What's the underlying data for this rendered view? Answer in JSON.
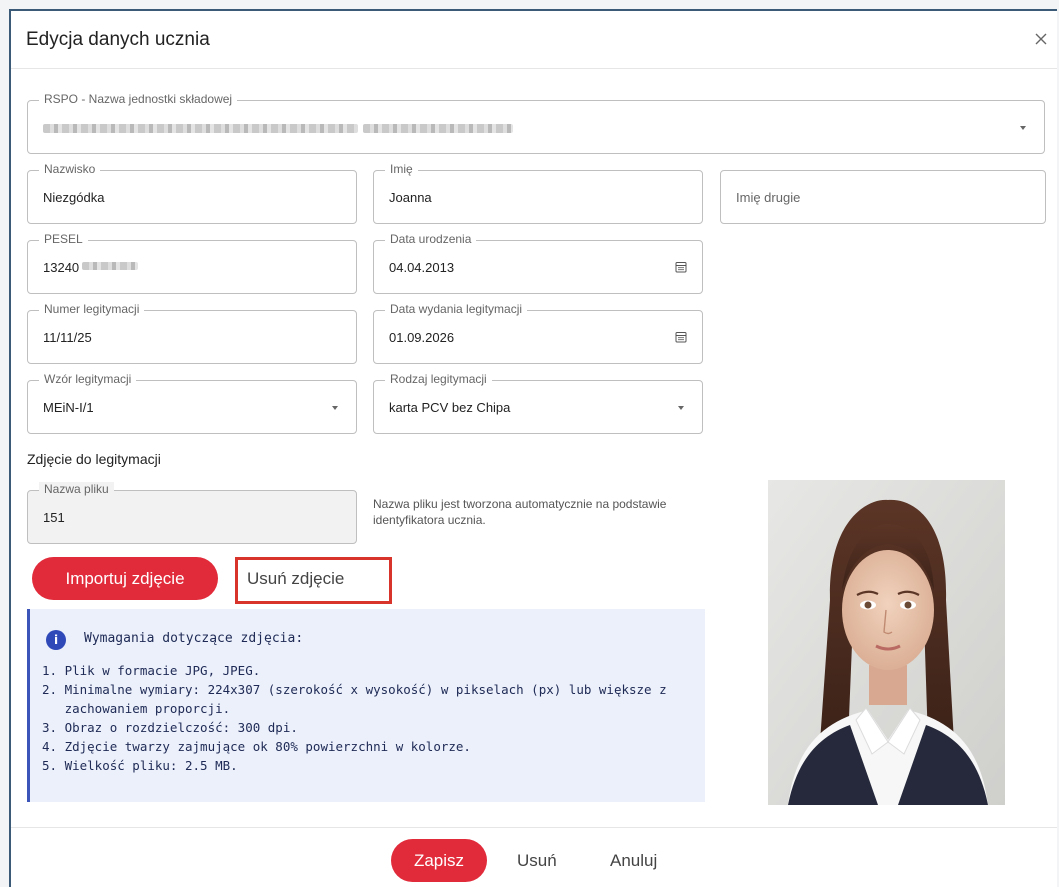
{
  "dialog": {
    "title": "Edycja danych ucznia"
  },
  "form": {
    "rspo": {
      "label": "RSPO - Nazwa jednostki składowej",
      "value": ""
    },
    "nazwisko": {
      "label": "Nazwisko",
      "value": "Niezgódka"
    },
    "imie": {
      "label": "Imię",
      "value": "Joanna"
    },
    "imie_drugie": {
      "placeholder": "Imię drugie",
      "value": ""
    },
    "pesel": {
      "label": "PESEL",
      "value": "13240"
    },
    "data_urodzenia": {
      "label": "Data urodzenia",
      "value": "04.04.2013"
    },
    "numer_legitymacji": {
      "label": "Numer legitymacji",
      "value": "11/11/25"
    },
    "data_wydania": {
      "label": "Data wydania legitymacji",
      "value": "01.09.2026"
    },
    "wzor": {
      "label": "Wzór legitymacji",
      "value": "MEiN-I/1"
    },
    "rodzaj": {
      "label": "Rodzaj legitymacji",
      "value": "karta PCV bez Chipa"
    }
  },
  "photo_section": {
    "title": "Zdjęcie do legitymacji",
    "file_name": {
      "label": "Nazwa pliku",
      "value": "151"
    },
    "hint": "Nazwa pliku jest tworzona automatycznie na podstawie identyfikatora ucznia.",
    "import_button": "Importuj zdjęcie",
    "remove_button": "Usuń zdjęcie"
  },
  "requirements": {
    "title": "Wymagania dotyczące zdjęcia:",
    "items": [
      "1. Plik w formacie JPG, JPEG.",
      "2. Minimalne wymiary: 224x307 (szerokość x wysokość) w pikselach (px) lub większe z",
      "   zachowaniem proporcji.",
      "3. Obraz o rozdzielczość: 300 dpi.",
      "4. Zdjęcie twarzy zajmujące ok 80% powierzchni w kolorze.",
      "5. Wielkość pliku: 2.5 MB."
    ]
  },
  "footer": {
    "save": "Zapisz",
    "delete": "Usuń",
    "cancel": "Anuluj"
  },
  "icons": {
    "close": "close-icon",
    "calendar": "calendar-icon",
    "dropdown": "chevron-down-icon",
    "info": "info-icon"
  },
  "colors": {
    "accent": "#e12b3a",
    "info_bg": "#ecf0fb",
    "info_border": "#3b55b8",
    "highlight": "#d9342b"
  }
}
